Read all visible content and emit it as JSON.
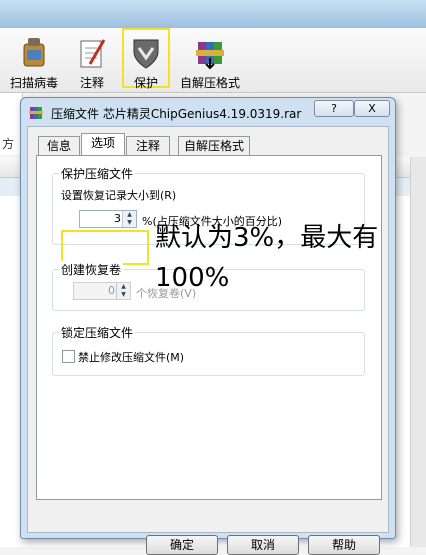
{
  "toolbar": {
    "scan_label": "扫描病毒",
    "comment_label": "注释",
    "protect_label": "保护",
    "sfx_label": "自解压格式"
  },
  "address_fragment": "方",
  "dialog": {
    "title": "压缩文件 芯片精灵ChipGenius4.19.0319.rar",
    "help_glyph": "?",
    "close_glyph": "X",
    "tabs": [
      {
        "label": "信息",
        "active": false
      },
      {
        "label": "选项",
        "active": true
      },
      {
        "label": "注释",
        "active": false
      },
      {
        "label": "自解压格式",
        "active": false
      }
    ],
    "protect_group": {
      "title": "保护压缩文件",
      "recovery_label": "设置恢复记录大小到(R)",
      "recovery_value": "3",
      "recovery_suffix": "%(占压缩文件大小的百分比)"
    },
    "volume_group": {
      "title": "创建恢复卷",
      "volume_value": "0",
      "volume_suffix": "个恢复卷(V)"
    },
    "lock_group": {
      "title": "锁定压缩文件",
      "lock_label": "禁止修改压缩文件(M)",
      "lock_checked": false
    },
    "buttons": {
      "ok": "确定",
      "cancel": "取消",
      "help": "帮助"
    }
  },
  "annotation": {
    "line1": "默认为3%，最大有",
    "line2": "100%"
  },
  "colors": {
    "highlight": "#f5e02a",
    "dialog_frame": "#cfe0f1"
  }
}
